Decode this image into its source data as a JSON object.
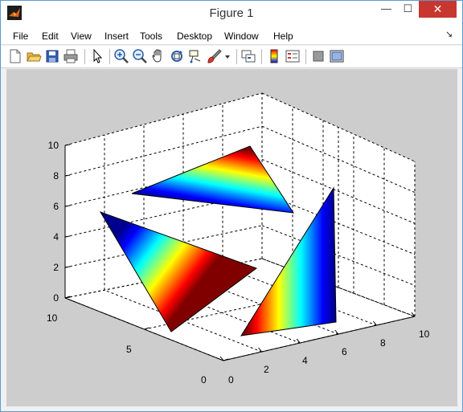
{
  "window": {
    "title": "Figure 1",
    "min_glyph": "—",
    "max_glyph": "☐",
    "close_glyph": "✕"
  },
  "menu": {
    "items": [
      "File",
      "Edit",
      "View",
      "Insert",
      "Tools",
      "Desktop",
      "Window",
      "Help"
    ],
    "overflow_glyph": "↘"
  },
  "toolbar": {
    "buttons": [
      "new-figure-icon",
      "open-file-icon",
      "save-icon",
      "print-icon",
      "edit-plot-arrow-icon",
      "zoom-in-icon",
      "zoom-out-icon",
      "pan-hand-icon",
      "rotate-3d-icon",
      "data-cursor-icon",
      "brush-icon",
      "brush-dropdown-icon",
      "link-plot-icon",
      "insert-colorbar-icon",
      "insert-legend-icon",
      "hide-plot-tools-icon",
      "show-plot-tools-icon"
    ]
  },
  "axes": {
    "z_ticks": [
      "0",
      "2",
      "4",
      "6",
      "8",
      "10"
    ],
    "x_ticks": [
      "0",
      "2",
      "4",
      "6",
      "8",
      "10"
    ],
    "y_ticks": [
      "0",
      "5",
      "10"
    ]
  },
  "colors": {
    "figure_bg": "#cdcdcd",
    "axes_bg": "#ffffff",
    "close_button": "#c7372f",
    "colormap": [
      "#00008f",
      "#0000ff",
      "#00ffff",
      "#ffff00",
      "#ff0000",
      "#800000"
    ]
  }
}
